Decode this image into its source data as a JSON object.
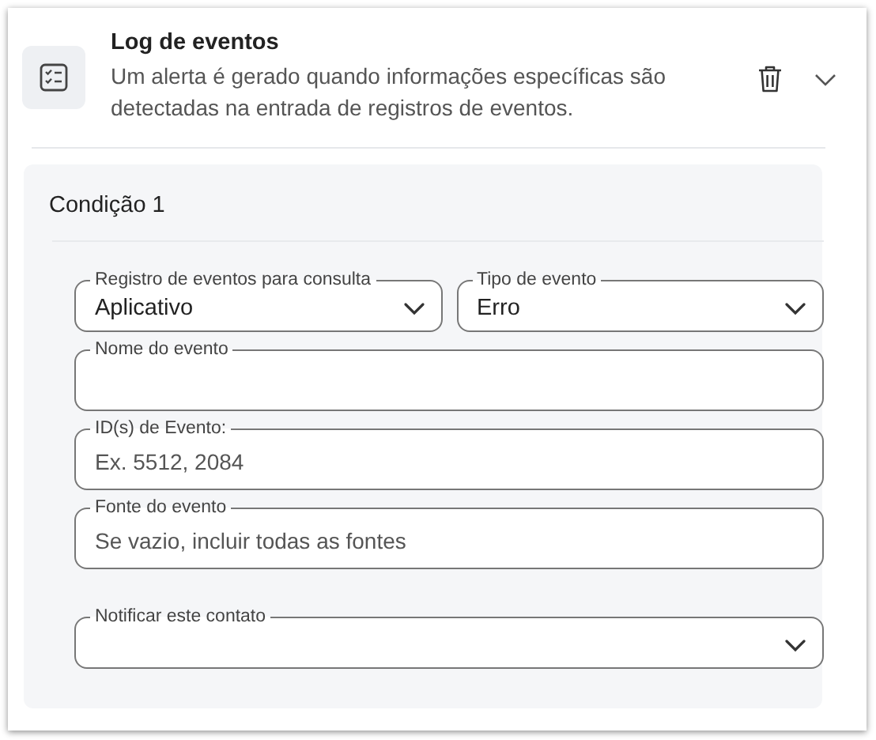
{
  "header": {
    "title": "Log de eventos",
    "description": "Um alerta é gerado quando informações específicas são detectadas na entrada de registros de eventos.",
    "expanded": true
  },
  "condition": {
    "title": "Condição 1",
    "rows": [
      [
        {
          "kind": "select",
          "label": "Registro de eventos para consulta",
          "value": "Aplicativo"
        },
        {
          "kind": "select",
          "label": "Tipo de evento",
          "value": "Erro"
        }
      ],
      [
        {
          "kind": "text",
          "label": "Nome do evento"
        }
      ],
      [
        {
          "kind": "text",
          "label": "ID(s) de Evento:",
          "placeholder": "Ex. 5512, 2084"
        }
      ],
      [
        {
          "kind": "text",
          "label": "Fonte do evento",
          "placeholder": "Se vazio, incluir todas as fontes"
        }
      ]
    ],
    "notify": {
      "kind": "select",
      "label": "Notificar este contato"
    }
  }
}
